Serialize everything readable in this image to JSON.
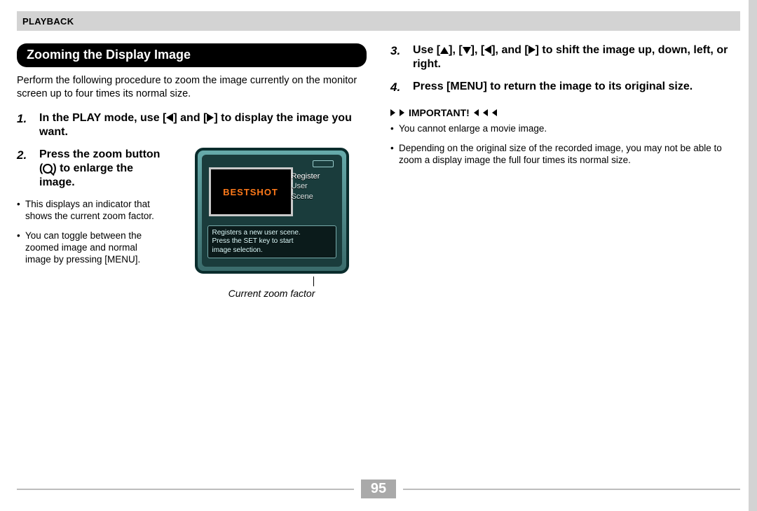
{
  "header": {
    "section": "PLAYBACK"
  },
  "title": "Zooming the Display Image",
  "intro": "Perform the following procedure to zoom the image currently on the monitor screen up to four times its normal size.",
  "steps": {
    "s1": {
      "num": "1.",
      "pre": "In the PLAY mode, use [",
      "mid": "] and [",
      "post": "] to display the image you want."
    },
    "s2": {
      "num": "2.",
      "pre": "Press the zoom button (",
      "post": ") to enlarge the image."
    },
    "s2_bullets": [
      "This displays an indicator that shows the current zoom factor.",
      "You can toggle between the zoomed image and normal image by pressing [MENU]."
    ],
    "s3": {
      "num": "3.",
      "pre": "Use [",
      "b1": "], [",
      "b2": "], [",
      "b3": "], and [",
      "post": "] to shift the image up, down, left, or right."
    },
    "s4": {
      "num": "4.",
      "text": "Press [MENU] to return the image to its original size."
    }
  },
  "figure": {
    "bestshot": "BESTSHOT",
    "menu": {
      "l1": "Register",
      "l2": "User",
      "l3": "Scene"
    },
    "strip": {
      "l1": "Registers a new user scene.",
      "l2": "Press the SET key to start",
      "l3": "image selection."
    },
    "caption": "Current zoom factor"
  },
  "important": {
    "label": "IMPORTANT!",
    "items": [
      "You cannot enlarge a movie image.",
      "Depending on the original size of the recorded image, you may not be able to zoom a display image the full four times its normal size."
    ]
  },
  "page_number": "95"
}
